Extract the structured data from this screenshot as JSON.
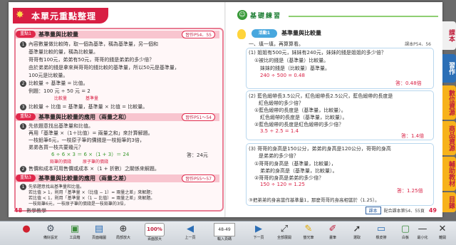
{
  "left": {
    "header": "本單元重點整理",
    "sections": [
      {
        "tag": "重點1",
        "title": "基準量與比較量",
        "ref": "習作P54、55",
        "lines": [
          "內容數量做比較時，取一個為基準，稱為基準量，另一個和",
          "基準量比較的量，稱為比較量。",
          "哥哥有100元，弟弟有50元，哥哥的錢是弟弟的多少倍？",
          "由於弟弟的錢是拿來與哥哥的錢比較的基準量，所以50元是基準量，",
          "100元是比較量。",
          "比較量 ÷ 基準量 = 比值。",
          "例題：100 元 ÷ 50 元 = 2",
          "比較量 ÷ 比值 = 基準量，基準量 × 比值 = 比較量。"
        ],
        "eq_labels": [
          "比較量",
          "基準量"
        ]
      },
      {
        "tag": "重點2",
        "title": "基準量與比較量的應用（兩量之和）",
        "ref": "習作P51～54",
        "lines": [
          "先依題意找出基準量和比值。",
          "再用「基準量 ×（1＋比值）= 兩量之和」來計算解題。",
          "一枝鉛筆6元，一枝原子筆的價錢是一枝鉛筆的3倍，",
          "弟弟各買一枝共要幾元？",
          "6 ÷ 6 × 3 ＝ 6 ×（1 + 3）＝ 24",
          "答：24元",
          "售價和成本可用售價或成本 ×（1 + 折數）之關係來解題。"
        ],
        "eq_labels": [
          "鉛筆的價錢",
          "原子筆的價錢"
        ]
      },
      {
        "tag": "重點3",
        "title": "基準量與比較量的應用（兩量之差）",
        "ref": "習作P55～57",
        "lines": [
          "先依題意找出基準量和比值。",
          "若比值 > 1，則用「基準量 ×（比值 − 1）= 兩量之差」來解題；",
          "若比值 < 1，則用「基準量 ×（1 − 比值）= 兩量之差」來解題。",
          "一枝鉛筆6元，一枝原子筆的價錢是一枝鉛筆的3倍，",
          "一枝鉛筆和一枝原子筆差幾元？",
          "6 × 3 − 6 ＝ 6 ×（3 − 1）＝ 12",
          "答：12元"
        ],
        "eq_labels": [
          "原子筆的價錢",
          "鉛筆的價錢"
        ]
      }
    ],
    "footer_page": "48",
    "footer_text": "數學教學"
  },
  "right": {
    "header": "基礎練習",
    "activity_tag": "活動1",
    "activity_title": "基準量與比較量",
    "ref": "課本P54、56",
    "q1": {
      "lead": "一、填一填，再算算看。",
      "stem": "(1) 姐姐有500元，妹妹有240元，妹妹的錢是姐姐的多少倍？",
      "a": "①被比的錢是（基準量）比較量。",
      "b": "妹妹的錢是（比較量）基準量。",
      "calc": "240 ÷ 500 = 0.48",
      "ans": "答：0.48倍"
    },
    "q2": {
      "stem": "(2) 藍色緞帶長3.5公尺，紅色緞帶長2.5公尺，藍色緞帶的長度是",
      "stem2": "紅色緞帶的多少倍？",
      "a": "①藍色緞帶的長度是（基準量，比較量）。",
      "b": "紅色緞帶的長度是（基準量，比較量）。",
      "c": "②藍色緞帶的長度是紅色緞帶的多少倍？",
      "calc": "3.5 ÷ 2.5 = 1.4",
      "ans": "答：1.4倍"
    },
    "q3": {
      "stem": "(3) 哥哥的身高是150公分，弟弟的身高是120公分，哥哥的身高",
      "stem2": "是弟弟的多少倍？",
      "a": "①哥哥的身高是（基準量，比較量），",
      "b": "弟弟的身高是（基準量，比較量）。",
      "c": "②哥哥的身高是弟弟的多少倍？",
      "calc": "150 ÷ 120 = 1.25",
      "ans": "答：1.25倍",
      "d": "③把弟弟的身高當作基準量1，那麼哥哥的身高相當於（1.25）。"
    },
    "footer_btn": "課本",
    "footer_text": "配合課本第54、55頁",
    "footer_page": "49"
  },
  "side_tabs": [
    {
      "label": "課本",
      "color": "#f0f0f0",
      "fg": "#c01e3c"
    },
    {
      "label": "習作",
      "color": "#2c6fb6",
      "fg": "#ffffff"
    },
    {
      "label": "數位資源",
      "color": "#f7b21b",
      "fg": "#c01e3c"
    },
    {
      "label": "商品資源",
      "color": "#f7b21b",
      "fg": "#c01e3c"
    },
    {
      "label": "輔助教材",
      "color": "#f7b21b",
      "fg": "#c01e3c"
    },
    {
      "label": "目錄",
      "color": "#f7b21b",
      "fg": "#c01e3c"
    }
  ],
  "toolbar": [
    {
      "label": "",
      "icon": "logo-icon"
    },
    {
      "label": "備好設定",
      "icon": "gear-icon"
    },
    {
      "label": "工具箱",
      "icon": "toolbox-icon"
    },
    {
      "label": "頁面縮圖",
      "icon": "thumbnail-icon"
    },
    {
      "label": "局部放大",
      "icon": "zoom-icon"
    },
    {
      "label": "百面放大",
      "icon": "zoom-percent-icon",
      "value": "100%"
    },
    {
      "label": "上一頁",
      "icon": "prev-page-icon"
    },
    {
      "label": "輸入頁碼",
      "icon": "page-input-icon",
      "value": "48-49"
    },
    {
      "label": "下一頁",
      "icon": "next-page-icon"
    },
    {
      "label": "全部展開",
      "icon": "expand-all-icon"
    },
    {
      "label": "螢光筆",
      "icon": "highlighter-icon"
    },
    {
      "label": "畫筆",
      "icon": "pen-icon"
    },
    {
      "label": "選取",
      "icon": "select-icon"
    },
    {
      "label": "橡皮擦",
      "icon": "eraser-icon"
    },
    {
      "label": "白板",
      "icon": "whiteboard-icon"
    },
    {
      "label": "最小化",
      "icon": "minimize-icon"
    },
    {
      "label": "離開",
      "icon": "exit-icon"
    }
  ]
}
